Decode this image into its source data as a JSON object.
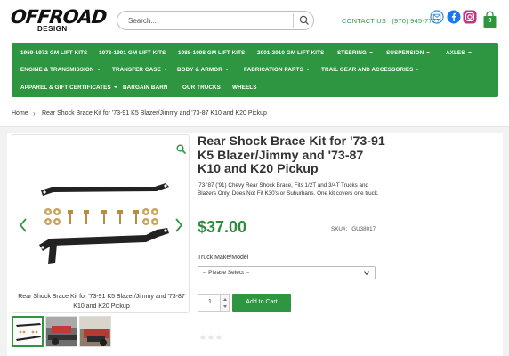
{
  "header": {
    "logo_main": "OFFROAD",
    "logo_sub": "DESIGN",
    "search_placeholder": "Search...",
    "contact_label": "CONTACT US",
    "phone": "(970) 945-7777",
    "cart_count": "0",
    "social_icons": [
      "email-icon",
      "facebook-icon",
      "instagram-icon"
    ],
    "colors": {
      "brand_green": "#2e9540",
      "facebook": "#1877f2",
      "instagram": "#c13584",
      "price_green": "#2e8b3e"
    }
  },
  "nav": {
    "items": [
      {
        "label": "1969-1972 GM LIFT KITS",
        "has_dropdown": false
      },
      {
        "label": "1973-1991 GM LIFT KITS",
        "has_dropdown": false
      },
      {
        "label": "1988-1998 GM LIFT KITS",
        "has_dropdown": false
      },
      {
        "label": "2001-2010 GM LIFT KITS",
        "has_dropdown": false
      },
      {
        "label": "STEERING",
        "has_dropdown": true
      },
      {
        "label": "SUSPENSION",
        "has_dropdown": true
      },
      {
        "label": "AXLES",
        "has_dropdown": true
      },
      {
        "label": "ENGINE & TRANSMISSION",
        "has_dropdown": true
      },
      {
        "label": "TRANSFER CASE",
        "has_dropdown": true
      },
      {
        "label": "BODY & ARMOR",
        "has_dropdown": true
      },
      {
        "label": "FABRICATION PARTS",
        "has_dropdown": true
      },
      {
        "label": "TRAIL GEAR AND ACCESSORIES",
        "has_dropdown": true
      },
      {
        "label": "APPAREL & GIFT CERTIFICATES",
        "has_dropdown": true
      },
      {
        "label": "BARGAIN BARN",
        "has_dropdown": false
      },
      {
        "label": "OUR TRUCKS",
        "has_dropdown": false
      },
      {
        "label": "WHEELS",
        "has_dropdown": false
      }
    ]
  },
  "breadcrumb": {
    "home": "Home",
    "separator": "›",
    "current": "Rear Shock Brace Kit for '73-91 K5 Blazer/Jimmy and '73-87 K10 and K20 Pickup"
  },
  "gallery": {
    "caption": "Rear Shock Brace Kit for '73-91 K5 Blazer/Jimmy and '73-87 K10 and K20 Pickup",
    "thumbnail_count": 3,
    "active_thumbnail": 1
  },
  "product": {
    "title": "Rear Shock Brace Kit for '73-91 K5 Blazer/Jimmy and '73-87 K10 and K20 Pickup",
    "description": "'73-'87 ('91) Chevy Rear Shock Brace, Fits 1/2T and 3/4T Trucks and Blazers Only, Does Not Fit K30's or Suburbans. One kit covers one truck.",
    "price": "$37.00",
    "sku_label": "SKU#:",
    "sku": "GU38017",
    "option_label": "Truck Make/Model",
    "option_selected": "-- Please Select --",
    "quantity": "1",
    "add_to_cart": "Add to Cart"
  }
}
